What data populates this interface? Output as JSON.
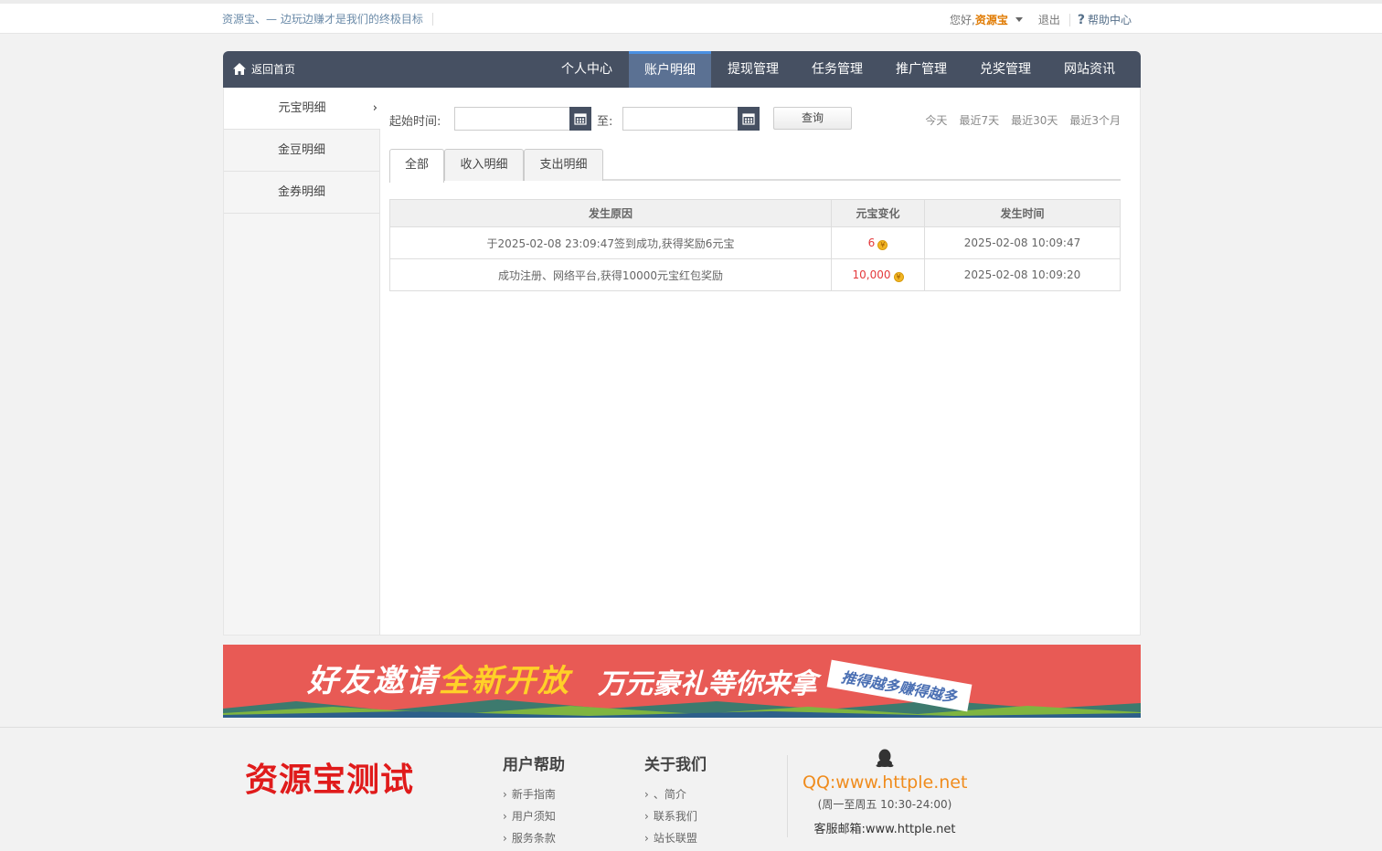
{
  "topbar": {
    "slogan": "资源宝、— 边玩边赚才是我们的终极目标",
    "greeting": "您好,",
    "username": "资源宝",
    "logout": "退出",
    "help": "帮助中心"
  },
  "nav": {
    "home": "返回首页",
    "items": [
      "个人中心",
      "账户明细",
      "提现管理",
      "任务管理",
      "推广管理",
      "兑奖管理",
      "网站资讯"
    ],
    "active_index": 1
  },
  "sidebar": {
    "items": [
      "元宝明细",
      "金豆明细",
      "金券明细"
    ],
    "active_index": 0
  },
  "filter": {
    "start_label": "起始时间:",
    "to_label": "至:",
    "start_value": "",
    "end_value": "",
    "query": "查询",
    "quick": [
      "今天",
      "最近7天",
      "最近30天",
      "最近3个月"
    ]
  },
  "tabs": [
    "全部",
    "收入明细",
    "支出明细"
  ],
  "table": {
    "headers": [
      "发生原因",
      "元宝变化",
      "发生时间"
    ],
    "rows": [
      {
        "reason": "于2025-02-08 23:09:47签到成功,获得奖励6元宝",
        "change": "6",
        "time": "2025-02-08 10:09:47"
      },
      {
        "reason": "成功注册、网络平台,获得10000元宝红包奖励",
        "change": "10,000",
        "time": "2025-02-08 10:09:20"
      }
    ]
  },
  "banner": {
    "part1": "好友邀请",
    "part1_highlight": "全新开放",
    "part2": "万元豪礼等你来拿",
    "part3": "推得越多赚得越多"
  },
  "footer": {
    "logo": "资源宝测试",
    "col1": {
      "title": "用户帮助",
      "links": [
        "新手指南",
        "用户须知",
        "服务条款"
      ]
    },
    "col2": {
      "title": "关于我们",
      "links": [
        "、简介",
        "联系我们",
        "站长联盟"
      ]
    },
    "qq": "QQ:www.httple.net",
    "hours": "(周一至周五 10:30-24:00)",
    "mail": "客服邮箱:www.httple.net"
  },
  "colors": {
    "nav_bg": "#465062",
    "nav_active": "#5b7193",
    "accent_orange": "#e07a00",
    "amount_red": "#e4393c",
    "banner_bg": "#e85a55",
    "logo_red": "#e01b1b"
  }
}
